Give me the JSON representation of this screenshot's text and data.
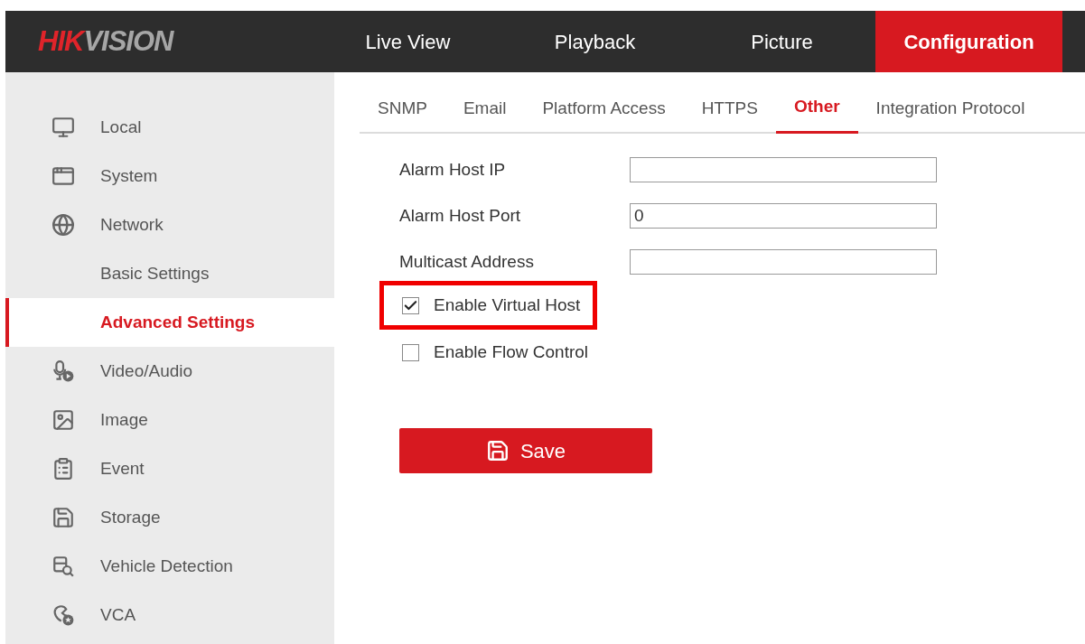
{
  "logo": {
    "text_red": "HIK",
    "text_gray": "VISION"
  },
  "nav": [
    {
      "label": "Live View",
      "selected": false
    },
    {
      "label": "Playback",
      "selected": false
    },
    {
      "label": "Picture",
      "selected": false
    },
    {
      "label": "Configuration",
      "selected": true
    }
  ],
  "sidebar": {
    "items": [
      {
        "label": "Local",
        "kind": "item",
        "selected": false
      },
      {
        "label": "System",
        "kind": "item",
        "selected": false
      },
      {
        "label": "Network",
        "kind": "item",
        "selected": false
      },
      {
        "label": "Basic Settings",
        "kind": "subitem",
        "selected": false
      },
      {
        "label": "Advanced Settings",
        "kind": "subitem",
        "selected": true
      },
      {
        "label": "Video/Audio",
        "kind": "item",
        "selected": false
      },
      {
        "label": "Image",
        "kind": "item",
        "selected": false
      },
      {
        "label": "Event",
        "kind": "item",
        "selected": false
      },
      {
        "label": "Storage",
        "kind": "item",
        "selected": false
      },
      {
        "label": "Vehicle Detection",
        "kind": "item",
        "selected": false
      },
      {
        "label": "VCA",
        "kind": "item",
        "selected": false
      }
    ]
  },
  "tabs": [
    {
      "label": "SNMP",
      "selected": false
    },
    {
      "label": "Email",
      "selected": false
    },
    {
      "label": "Platform Access",
      "selected": false
    },
    {
      "label": "HTTPS",
      "selected": false
    },
    {
      "label": "Other",
      "selected": true
    },
    {
      "label": "Integration Protocol",
      "selected": false
    }
  ],
  "fields": [
    {
      "label": "Alarm Host IP"
    },
    {
      "label": "Alarm Host Port",
      "value": "0"
    },
    {
      "label": "Multicast Address"
    }
  ],
  "checkboxes": [
    {
      "label": "Enable Virtual Host",
      "checked": true,
      "highlighted": true
    },
    {
      "label": "Enable Flow Control",
      "checked": false,
      "highlighted": false
    }
  ],
  "save_button": {
    "label": "Save"
  }
}
